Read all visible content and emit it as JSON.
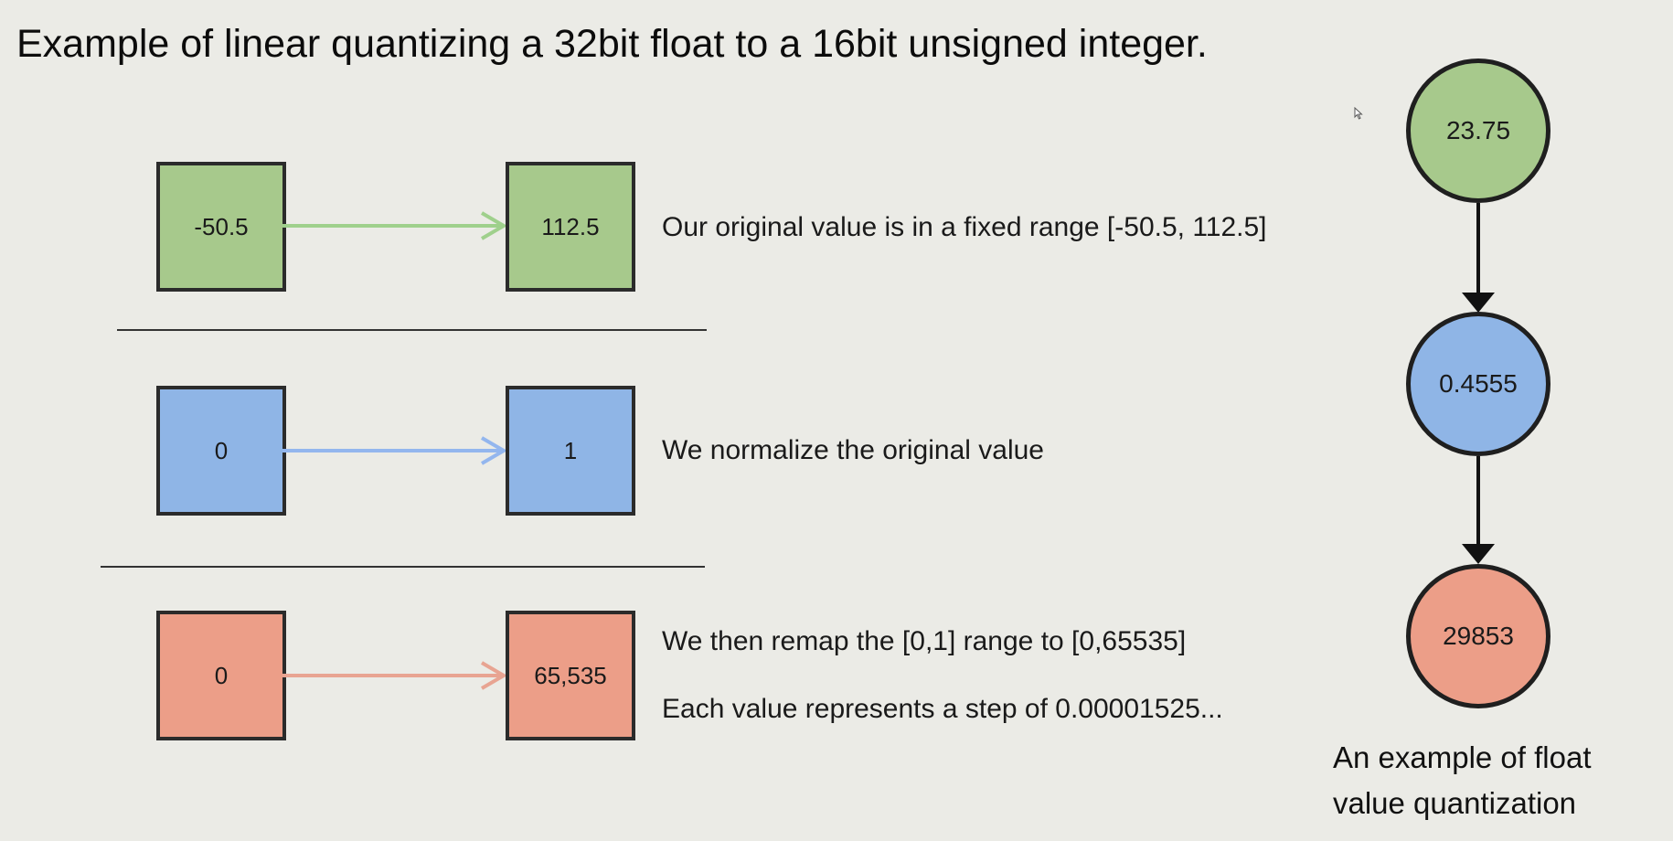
{
  "title": "Example of linear quantizing a 32bit float to a 16bit unsigned integer.",
  "colors": {
    "green": "#a7c98c",
    "blue": "#8fb5e6",
    "red": "#ec9e88",
    "green_arrow": "#9fd08c",
    "blue_arrow": "#93b6ee",
    "red_arrow": "#e8a492"
  },
  "rows": [
    {
      "left_value": "-50.5",
      "right_value": "112.5",
      "description": "Our original value is in a fixed range [-50.5, 112.5]",
      "color": "green"
    },
    {
      "left_value": "0",
      "right_value": "1",
      "description": "We normalize the original value",
      "color": "blue"
    },
    {
      "left_value": "0",
      "right_value": "65,535",
      "description": "We then remap the [0,1] range to [0,65535]",
      "description2": "Each value represents a step of 0.00001525...",
      "color": "red"
    }
  ],
  "example": {
    "nodes": [
      {
        "value": "23.75",
        "color": "green"
      },
      {
        "value": "0.4555",
        "color": "blue"
      },
      {
        "value": "29853",
        "color": "red"
      }
    ],
    "caption": "An example of float value quantization"
  }
}
